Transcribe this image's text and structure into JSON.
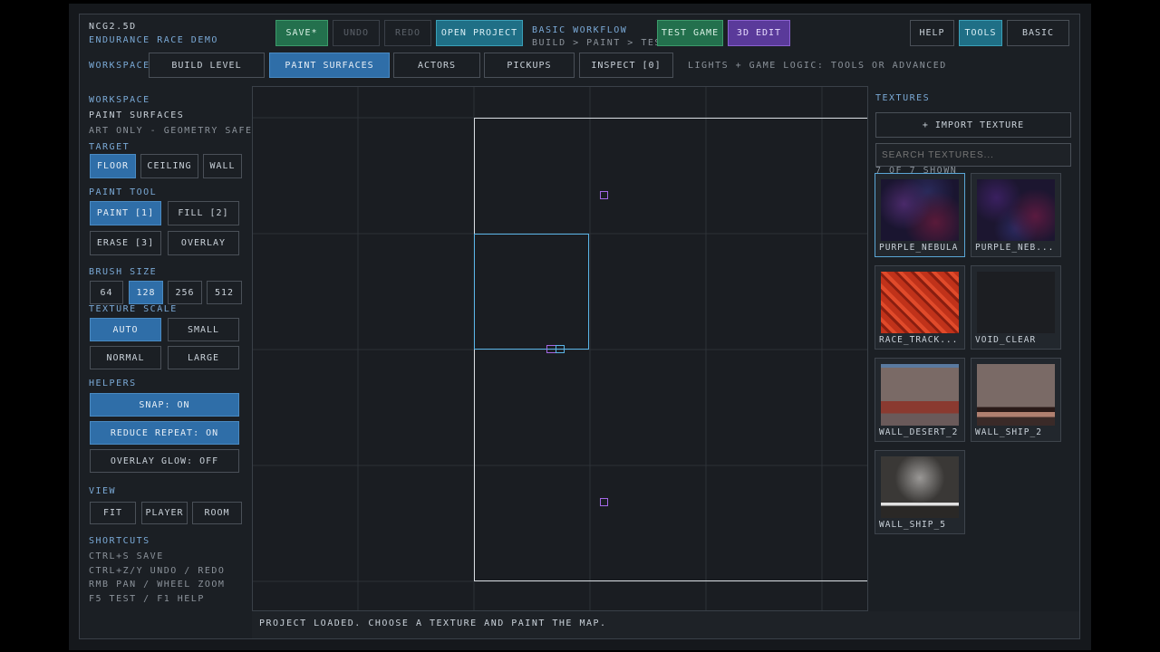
{
  "app": {
    "title": "NCG2.5D",
    "project": "ENDURANCE RACE DEMO"
  },
  "toolbar": {
    "save": "SAVE*",
    "undo": "UNDO",
    "redo": "REDO",
    "open_project": "OPEN PROJECT",
    "workflow_title": "BASIC WORKFLOW",
    "workflow_steps": "BUILD > PAINT > TEST",
    "test_game": "TEST GAME",
    "edit_3d": "3D EDIT",
    "help": "HELP",
    "tools": "TOOLS",
    "basic": "BASIC"
  },
  "workspaces": {
    "label": "WORKSPACES",
    "tabs": [
      "BUILD LEVEL",
      "PAINT SURFACES",
      "ACTORS",
      "PICKUPS",
      "INSPECT [0]"
    ],
    "active": "PAINT SURFACES",
    "hint": "LIGHTS + GAME LOGIC: TOOLS OR ADVANCED"
  },
  "sidebar": {
    "workspace_label": "WORKSPACE",
    "workspace_name": "PAINT SURFACES",
    "workspace_note": "ART ONLY - GEOMETRY SAFE",
    "target_label": "TARGET",
    "targets": [
      "FLOOR",
      "CEILING",
      "WALL"
    ],
    "paint_tool_label": "PAINT TOOL",
    "tools": [
      "PAINT [1]",
      "FILL [2]",
      "ERASE [3]",
      "OVERLAY"
    ],
    "brush_size_label": "BRUSH SIZE",
    "brush_sizes": [
      "64",
      "128",
      "256",
      "512"
    ],
    "texture_scale_label": "TEXTURE SCALE",
    "scales": [
      "AUTO",
      "SMALL",
      "NORMAL",
      "LARGE"
    ],
    "helpers_label": "HELPERS",
    "snap": "SNAP: ON",
    "reduce_repeat": "REDUCE REPEAT: ON",
    "overlay_glow": "OVERLAY GLOW: OFF",
    "view_label": "VIEW",
    "views": [
      "FIT",
      "PLAYER",
      "ROOM"
    ],
    "shortcuts_label": "SHORTCUTS",
    "shortcuts": [
      "CTRL+S SAVE",
      "CTRL+Z/Y UNDO / REDO",
      "RMB PAN / WHEEL ZOOM",
      "F5 TEST / F1 HELP"
    ]
  },
  "textures": {
    "label": "TEXTURES",
    "import": "+ IMPORT TEXTURE",
    "search_placeholder": "SEARCH TEXTURES...",
    "count": "7 OF 7 SHOWN",
    "items": [
      "PURPLE_NEBULA",
      "PURPLE_NEB...",
      "RACE_TRACK...",
      "VOID_CLEAR",
      "WALL_DESERT_2",
      "WALL_SHIP_2",
      "WALL_SHIP_5"
    ]
  },
  "status": "PROJECT LOADED. CHOOSE A TEXTURE AND PAINT THE MAP.",
  "colors": {
    "accent_blue": "#2f6ea8",
    "save_green": "#23704d",
    "edit_purple": "#5a3a9a",
    "label_blue": "#7aa9d6"
  }
}
